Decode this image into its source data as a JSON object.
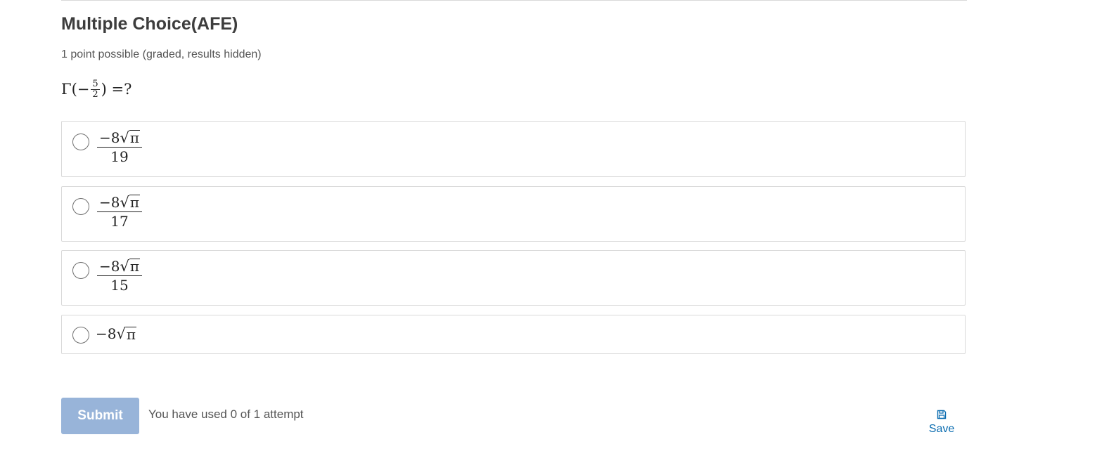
{
  "problem": {
    "title": "Multiple Choice(AFE)",
    "subtitle": "1 point possible (graded, results hidden)",
    "question": {
      "lhs": "Γ(−",
      "frac_num": "5",
      "frac_den": "2",
      "rhs": ") =?"
    }
  },
  "choices": [
    {
      "coef": "−8",
      "radicand": "π",
      "denominator": "19"
    },
    {
      "coef": "−8",
      "radicand": "π",
      "denominator": "17"
    },
    {
      "coef": "−8",
      "radicand": "π",
      "denominator": "15"
    },
    {
      "coef": "−8",
      "radicand": "π"
    }
  ],
  "actions": {
    "submit_label": "Submit",
    "attempts_text": "You have used 0 of 1 attempt",
    "save_label": "Save",
    "save_icon": "floppy-disk-icon"
  },
  "colors": {
    "submit_bg": "#98b4d9",
    "link": "#0a6cb0",
    "border": "#d9d9d9"
  }
}
